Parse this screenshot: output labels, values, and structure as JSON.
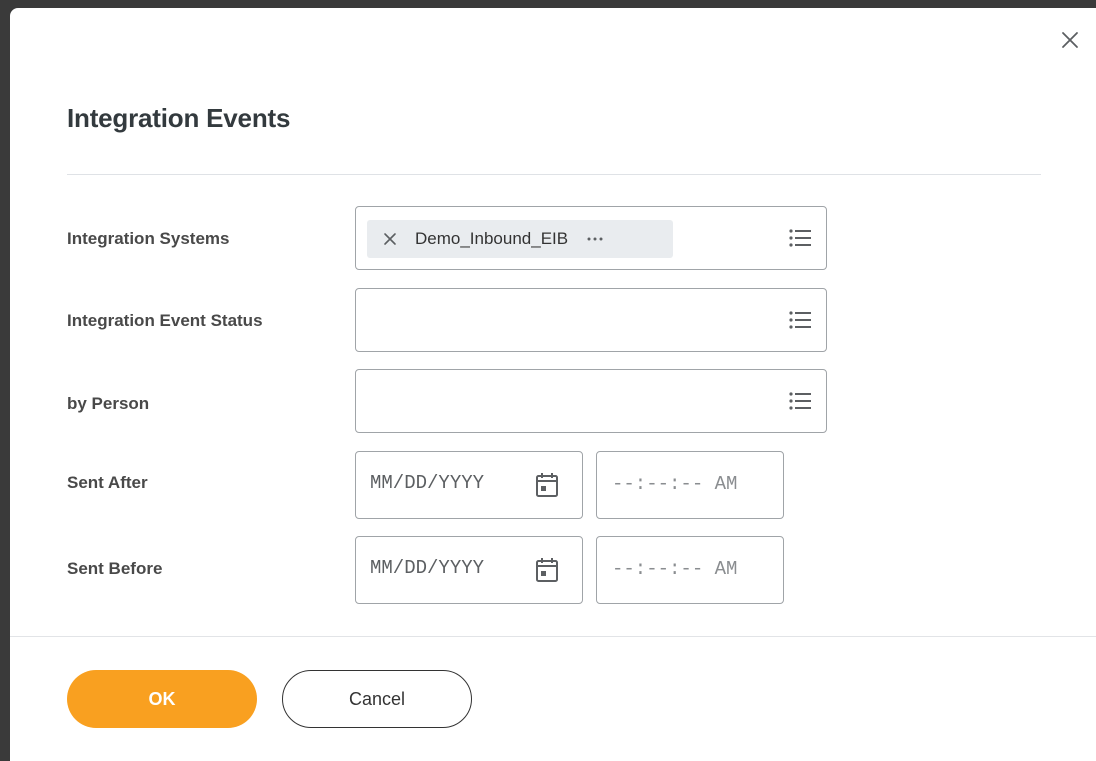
{
  "dialog": {
    "title": "Integration Events"
  },
  "icons": {
    "close": "close-icon",
    "prompt": "list-icon",
    "calendar": "calendar-icon",
    "remove": "x-icon",
    "more": "ellipsis-icon"
  },
  "fields": {
    "integration_systems": {
      "label": "Integration Systems",
      "selected": "Demo_Inbound_EIB"
    },
    "integration_event_status": {
      "label": "Integration Event Status"
    },
    "by_person": {
      "label": "by Person"
    },
    "sent_after": {
      "label": "Sent After",
      "date_placeholder": "MM/DD/YYYY",
      "time_placeholder": "--:--:-- AM"
    },
    "sent_before": {
      "label": "Sent Before",
      "date_placeholder": "MM/DD/YYYY",
      "time_placeholder": "--:--:-- AM"
    }
  },
  "buttons": {
    "ok": "OK",
    "cancel": "Cancel"
  },
  "colors": {
    "primary": "#f9a020",
    "pill_bg": "#e9ecef",
    "border": "#a0a4a8"
  }
}
